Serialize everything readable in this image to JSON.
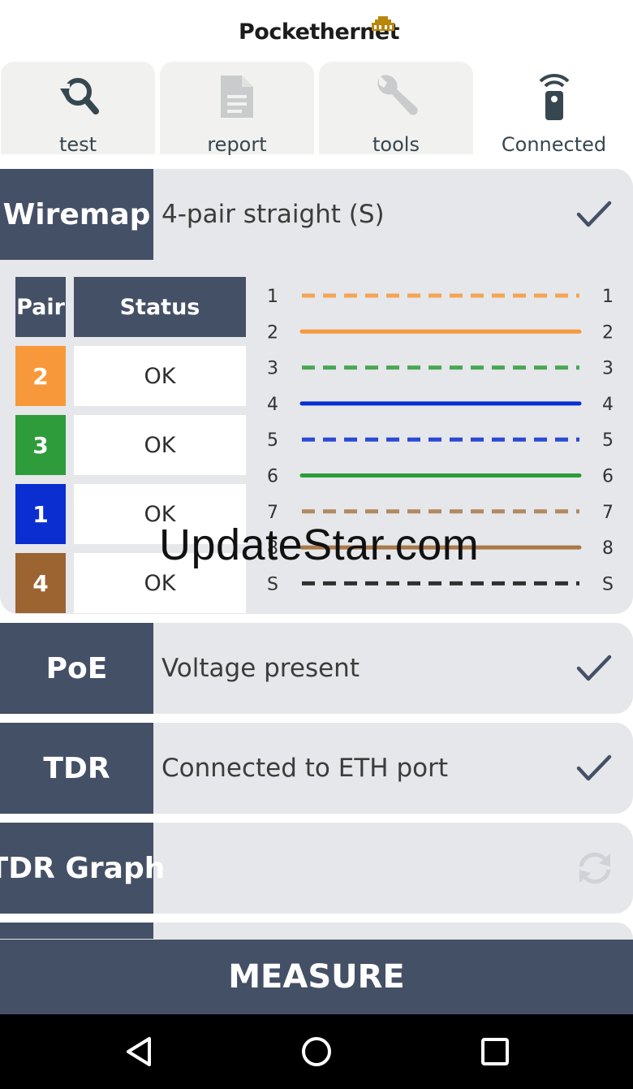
{
  "app": {
    "logo": "Pockethernet"
  },
  "tabs": [
    {
      "label": "test",
      "icon": "search-refresh-icon"
    },
    {
      "label": "report",
      "icon": "document-icon"
    },
    {
      "label": "tools",
      "icon": "wrench-icon"
    },
    {
      "label": "Connected",
      "icon": "remote-device-icon",
      "active": true
    }
  ],
  "wiremap": {
    "label": "Wiremap",
    "value": "4-pair straight (S)",
    "table": {
      "pair_header": "Pair",
      "status_header": "Status",
      "rows": [
        {
          "pair": "2",
          "status": "OK",
          "color": "#f7993a"
        },
        {
          "pair": "3",
          "status": "OK",
          "color": "#2e9c3a"
        },
        {
          "pair": "1",
          "status": "OK",
          "color": "#0b2ed1"
        },
        {
          "pair": "4",
          "status": "OK",
          "color": "#9c6431"
        }
      ]
    },
    "wires": [
      {
        "left": "1",
        "right": "1",
        "color": "#f7993a",
        "dashed": true
      },
      {
        "left": "2",
        "right": "2",
        "color": "#f7993a",
        "dashed": false
      },
      {
        "left": "3",
        "right": "3",
        "color": "#2e9c3a",
        "dashed": true
      },
      {
        "left": "4",
        "right": "4",
        "color": "#0b2ed1",
        "dashed": false
      },
      {
        "left": "5",
        "right": "5",
        "color": "#0b2ed1",
        "dashed": true
      },
      {
        "left": "6",
        "right": "6",
        "color": "#2e9c3a",
        "dashed": false
      },
      {
        "left": "7",
        "right": "7",
        "color": "#a9794a",
        "dashed": true
      },
      {
        "left": "8",
        "right": "8",
        "color": "#a9794a",
        "dashed": false
      },
      {
        "left": "S",
        "right": "S",
        "color": "#111111",
        "dashed": true
      }
    ]
  },
  "poe": {
    "label": "PoE",
    "value": "Voltage present"
  },
  "tdr": {
    "label": "TDR",
    "value": "Connected to ETH port"
  },
  "tdr_graph": {
    "label": "TDR Graph",
    "value": ""
  },
  "watermark": "UpdateStar.com",
  "measure": {
    "label": "MEASURE"
  },
  "colors": {
    "panel": "#445066",
    "card": "#e6e7ea"
  }
}
